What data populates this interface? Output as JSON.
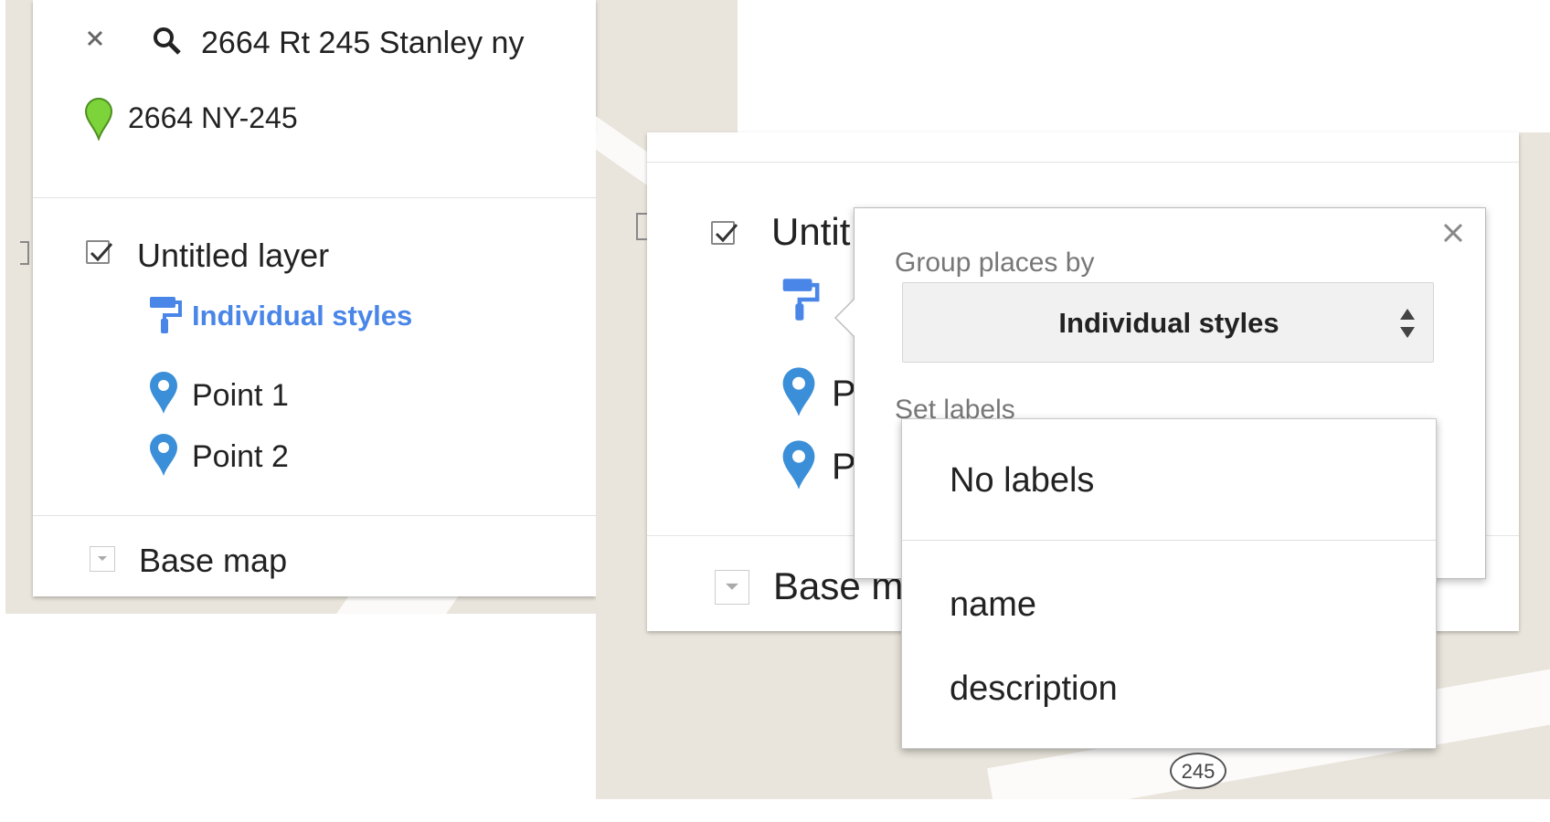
{
  "search": {
    "query": "2664 Rt 245 Stanley ny",
    "result": "2664 NY-245"
  },
  "layer": {
    "title": "Untitled layer",
    "title_clipped": "Untit",
    "style_label": "Individual styles",
    "points": [
      "Point 1",
      "Point 2"
    ],
    "point_prefix": "P"
  },
  "base_map": {
    "label": "Base map",
    "label_clipped": "Base m"
  },
  "style_popup": {
    "group_label": "Group places by",
    "group_value": "Individual styles",
    "labels_label": "Set labels"
  },
  "labels_dropdown": {
    "options": [
      "No labels",
      "name",
      "description"
    ]
  },
  "map": {
    "route_shield": "245"
  },
  "colors": {
    "accent_blue": "#4a86e8",
    "pin_blue": "#3b8fd8",
    "pin_green": "#7cd33a",
    "map_bg": "#e9e5dc"
  }
}
